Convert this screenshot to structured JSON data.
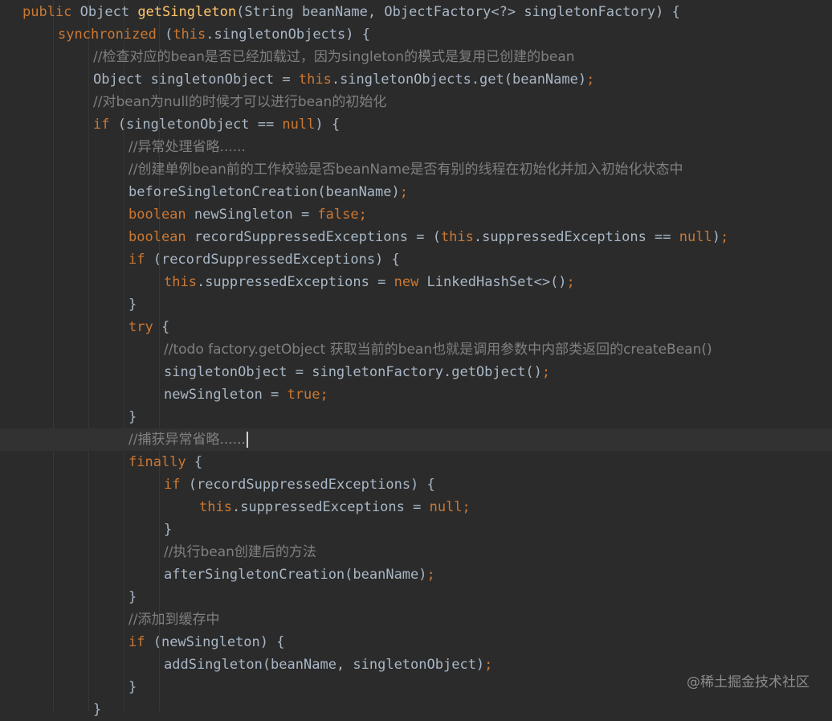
{
  "colors": {
    "background": "#2b2b2b",
    "keyword": "#cc7832",
    "comment": "#808080",
    "method_decl": "#ffc66d",
    "plain": "#a9b7c6",
    "current_line": "#323232"
  },
  "code": {
    "lines": [
      {
        "indent": 0,
        "tokens": [
          [
            "kw",
            "public "
          ],
          [
            "pl",
            "Object "
          ],
          [
            "fn",
            "getSingleton"
          ],
          [
            "pl",
            "(String beanName, ObjectFactory<?> singletonFactory) {"
          ]
        ]
      },
      {
        "indent": 1,
        "tokens": [
          [
            "kw",
            "synchronized "
          ],
          [
            "pl",
            "("
          ],
          [
            "kw",
            "this"
          ],
          [
            "pl",
            ".singletonObjects) {"
          ]
        ]
      },
      {
        "indent": 2,
        "tokens": [
          [
            "cm",
            "//检查对应的bean是否已经加载过，因为singleton的模式是复用已创建的bean"
          ]
        ]
      },
      {
        "indent": 2,
        "tokens": [
          [
            "pl",
            "Object singletonObject = "
          ],
          [
            "kw",
            "this"
          ],
          [
            "pl",
            ".singletonObjects.get(beanName)"
          ],
          [
            "kw",
            ";"
          ]
        ]
      },
      {
        "indent": 2,
        "tokens": [
          [
            "cm",
            "//对bean为null的时候才可以进行bean的初始化"
          ]
        ]
      },
      {
        "indent": 2,
        "tokens": [
          [
            "kw",
            "if "
          ],
          [
            "pl",
            "(singletonObject == "
          ],
          [
            "kw",
            "null"
          ],
          [
            "pl",
            ") {"
          ]
        ]
      },
      {
        "indent": 3,
        "tokens": [
          [
            "cm",
            "//异常处理省略......"
          ]
        ]
      },
      {
        "indent": 3,
        "tokens": [
          [
            "cm",
            "//创建单例bean前的工作校验是否beanName是否有别的线程在初始化并加入初始化状态中"
          ]
        ]
      },
      {
        "indent": 3,
        "tokens": [
          [
            "pl",
            "beforeSingletonCreation(beanName)"
          ],
          [
            "kw",
            ";"
          ]
        ]
      },
      {
        "indent": 3,
        "tokens": [
          [
            "kw",
            "boolean "
          ],
          [
            "pl",
            "newSingleton = "
          ],
          [
            "kw",
            "false;"
          ]
        ]
      },
      {
        "indent": 3,
        "tokens": [
          [
            "kw",
            "boolean "
          ],
          [
            "pl",
            "recordSuppressedExceptions = ("
          ],
          [
            "kw",
            "this"
          ],
          [
            "pl",
            ".suppressedExceptions == "
          ],
          [
            "kw",
            "null"
          ],
          [
            "pl",
            ")"
          ],
          [
            "kw",
            ";"
          ]
        ]
      },
      {
        "indent": 3,
        "tokens": [
          [
            "kw",
            "if "
          ],
          [
            "pl",
            "(recordSuppressedExceptions) {"
          ]
        ]
      },
      {
        "indent": 4,
        "tokens": [
          [
            "kw",
            "this"
          ],
          [
            "pl",
            ".suppressedExceptions = "
          ],
          [
            "kw",
            "new "
          ],
          [
            "pl",
            "LinkedHashSet<>()"
          ],
          [
            "kw",
            ";"
          ]
        ]
      },
      {
        "indent": 3,
        "tokens": [
          [
            "pl",
            "}"
          ]
        ]
      },
      {
        "indent": 3,
        "tokens": [
          [
            "kw",
            "try "
          ],
          [
            "pl",
            "{"
          ]
        ]
      },
      {
        "indent": 4,
        "tokens": [
          [
            "cm",
            "//todo factory.getObject 获取当前的bean也就是调用参数中内部类返回的createBean()"
          ]
        ]
      },
      {
        "indent": 4,
        "tokens": [
          [
            "pl",
            "singletonObject = singletonFactory.getObject()"
          ],
          [
            "kw",
            ";"
          ]
        ]
      },
      {
        "indent": 4,
        "tokens": [
          [
            "pl",
            "newSingleton = "
          ],
          [
            "kw",
            "true;"
          ]
        ]
      },
      {
        "indent": 3,
        "tokens": [
          [
            "pl",
            "}"
          ]
        ]
      },
      {
        "indent": 3,
        "current": true,
        "caret": true,
        "tokens": [
          [
            "cm",
            "//捕获异常省略......"
          ]
        ]
      },
      {
        "indent": 3,
        "tokens": [
          [
            "kw",
            "finally "
          ],
          [
            "pl",
            "{"
          ]
        ]
      },
      {
        "indent": 4,
        "tokens": [
          [
            "kw",
            "if "
          ],
          [
            "pl",
            "(recordSuppressedExceptions) {"
          ]
        ]
      },
      {
        "indent": 5,
        "tokens": [
          [
            "kw",
            "this"
          ],
          [
            "pl",
            ".suppressedExceptions = "
          ],
          [
            "kw",
            "null;"
          ]
        ]
      },
      {
        "indent": 4,
        "tokens": [
          [
            "pl",
            "}"
          ]
        ]
      },
      {
        "indent": 4,
        "tokens": [
          [
            "cm",
            "//执行bean创建后的方法"
          ]
        ]
      },
      {
        "indent": 4,
        "tokens": [
          [
            "pl",
            "afterSingletonCreation(beanName)"
          ],
          [
            "kw",
            ";"
          ]
        ]
      },
      {
        "indent": 3,
        "tokens": [
          [
            "pl",
            "}"
          ]
        ]
      },
      {
        "indent": 3,
        "tokens": [
          [
            "cm",
            "//添加到缓存中"
          ]
        ]
      },
      {
        "indent": 3,
        "tokens": [
          [
            "kw",
            "if "
          ],
          [
            "pl",
            "(newSingleton) {"
          ]
        ]
      },
      {
        "indent": 4,
        "tokens": [
          [
            "pl",
            "addSingleton(beanName, singletonObject)"
          ],
          [
            "kw",
            ";"
          ]
        ]
      },
      {
        "indent": 3,
        "tokens": [
          [
            "pl",
            "}"
          ]
        ]
      },
      {
        "indent": 2,
        "tokens": [
          [
            "pl",
            "}"
          ]
        ]
      }
    ]
  },
  "watermark": "@稀土掘金技术社区"
}
